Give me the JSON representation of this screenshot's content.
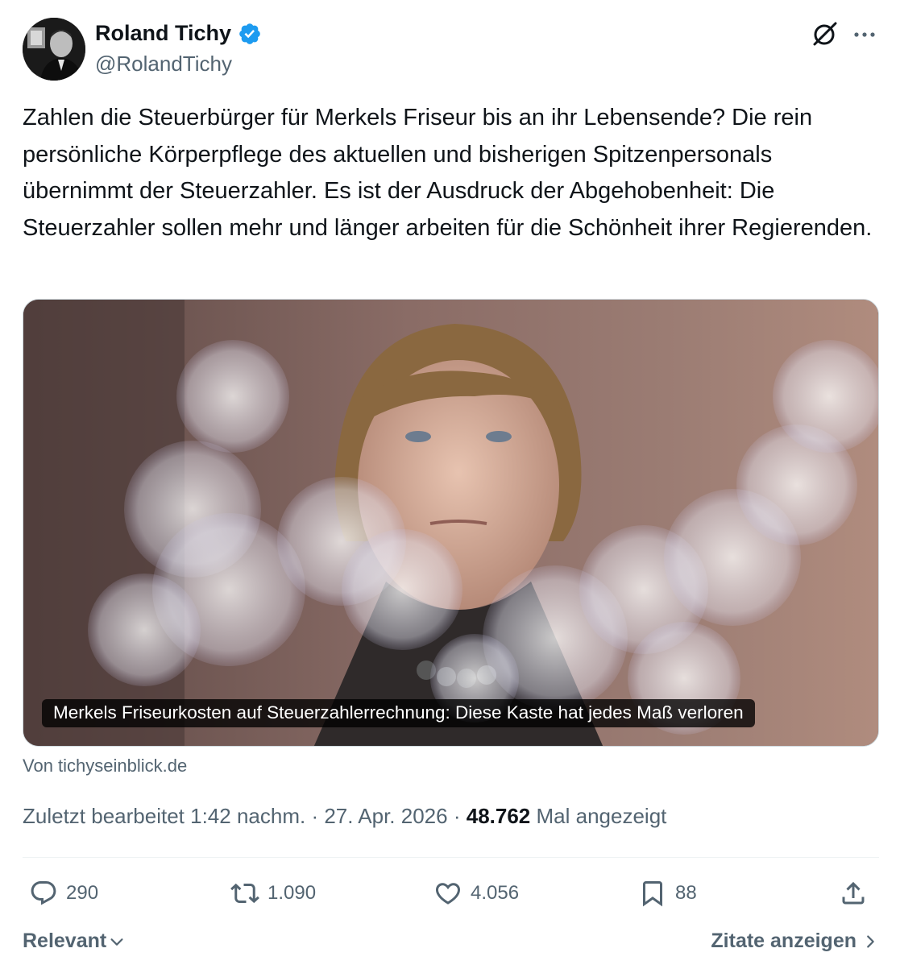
{
  "author": {
    "display_name": "Roland Tichy",
    "handle": "@RolandTichy",
    "verified": true,
    "verified_color": "#1d9bf0"
  },
  "header_icons": [
    "grok-icon",
    "more-icon"
  ],
  "tweet": {
    "text": "Zahlen die Steuerbürger für Merkels Friseur bis an ihr Lebensende? Die rein persönliche Körperpflege des aktuellen und bisherigen Spitzenpersonals übernimmt der Steuerzahler. Es ist der Ausdruck der Abgehobenheit: Die Steuerzahler sollen mehr und länger arbeiten für die Schönheit ihrer Regierenden."
  },
  "link_card": {
    "caption": "Merkels Friseurkosten auf Steuerzahlerrechnung: Diese Kaste hat jedes Maß verloren",
    "source": "Von tichyseinblick.de"
  },
  "meta": {
    "edited_label": "Zuletzt bearbeitet 1:42 nachm.",
    "separator": "·",
    "date": "27. Apr. 2026",
    "views_count": "48.762",
    "views_label": "Mal angezeigt"
  },
  "actions": {
    "replies": "290",
    "reposts": "1.090",
    "likes": "4.056",
    "bookmarks": "88"
  },
  "footer": {
    "sort_label": "Relevant",
    "quotes_label": "Zitate anzeigen"
  }
}
